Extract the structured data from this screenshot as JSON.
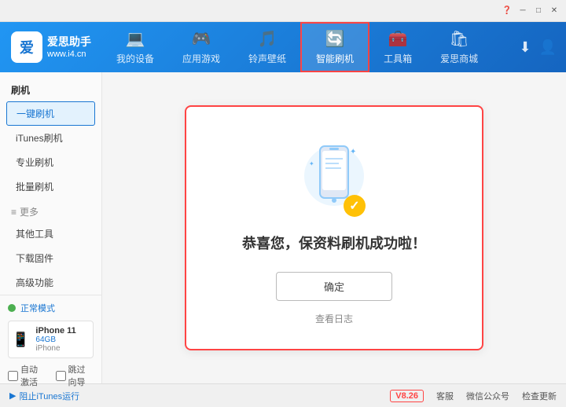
{
  "titleBar": {
    "controls": [
      "minimize",
      "maximize",
      "close"
    ]
  },
  "header": {
    "logo": {
      "icon": "爱",
      "brandName": "爱思助手",
      "url": "www.i4.cn"
    },
    "tabs": [
      {
        "id": "my-device",
        "label": "我的设备",
        "icon": "💻",
        "active": false
      },
      {
        "id": "apps-games",
        "label": "应用游戏",
        "icon": "🎮",
        "active": false
      },
      {
        "id": "ringtones",
        "label": "铃声壁纸",
        "icon": "🎵",
        "active": false
      },
      {
        "id": "smart-flash",
        "label": "智能刷机",
        "icon": "🔄",
        "active": true
      },
      {
        "id": "toolbox",
        "label": "工具箱",
        "icon": "🧰",
        "active": false
      },
      {
        "id": "store",
        "label": "爱思商城",
        "icon": "🛍",
        "active": false
      }
    ]
  },
  "sidebar": {
    "sections": [
      {
        "title": "刷机",
        "items": [
          {
            "id": "one-key-flash",
            "label": "一键刷机",
            "active": true
          },
          {
            "id": "itunes-flash",
            "label": "iTunes刷机",
            "active": false
          },
          {
            "id": "pro-flash",
            "label": "专业刷机",
            "active": false
          },
          {
            "id": "batch-flash",
            "label": "批量刷机",
            "active": false
          }
        ]
      },
      {
        "title": "更多",
        "items": [
          {
            "id": "other-tools",
            "label": "其他工具",
            "active": false
          },
          {
            "id": "download-firmware",
            "label": "下载固件",
            "active": false
          },
          {
            "id": "advanced",
            "label": "高级功能",
            "active": false
          }
        ]
      }
    ],
    "deviceMode": {
      "label": "正常模式",
      "statusColor": "#4CAF50"
    },
    "device": {
      "name": "iPhone 11",
      "storage": "64GB",
      "type": "iPhone"
    },
    "checkboxes": [
      {
        "id": "auto-activate",
        "label": "自动激活"
      },
      {
        "id": "skip-guide",
        "label": "跳过向导"
      }
    ]
  },
  "successCard": {
    "message": "恭喜您，保资料刷机成功啦！",
    "confirmButton": "确定",
    "viewLogLink": "查看日志"
  },
  "footer": {
    "itunesLabel": "阻止iTunes运行",
    "version": "V8.26",
    "links": [
      {
        "id": "support",
        "label": "客服"
      },
      {
        "id": "wechat",
        "label": "微信公众号"
      },
      {
        "id": "check-update",
        "label": "检查更新"
      }
    ]
  }
}
